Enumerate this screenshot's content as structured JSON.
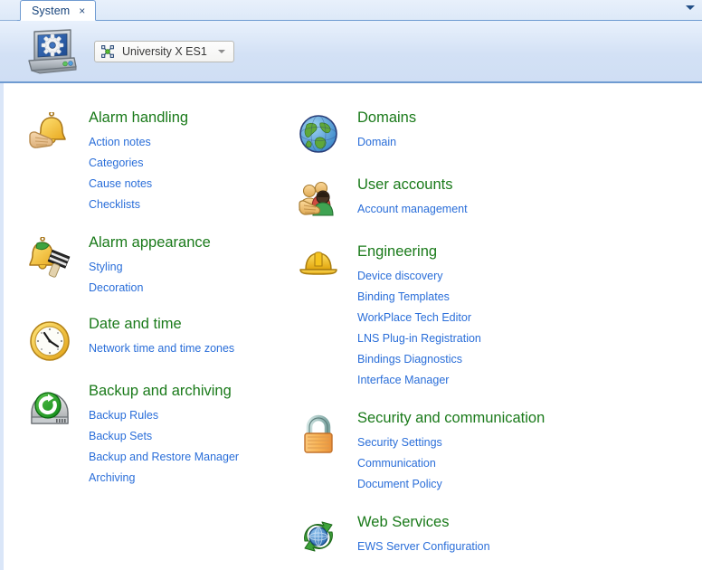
{
  "window": {
    "tab": {
      "label": "System",
      "close_icon": "close-icon",
      "close_glyph": "×"
    },
    "tabstrip_overflow_icon": "chevron-down-icon"
  },
  "header": {
    "app_icon": "laptop-settings-icon",
    "site_selector": {
      "icon": "network-nodes-icon",
      "value": "University X ES1",
      "caret_icon": "chevron-down-icon"
    }
  },
  "columns": {
    "left": [
      {
        "icon": "bell-hand-icon",
        "title": "Alarm handling",
        "links": [
          "Action notes",
          "Categories",
          "Cause notes",
          "Checklists"
        ]
      },
      {
        "icon": "bell-paintbrush-icon",
        "title": "Alarm appearance",
        "links": [
          "Styling",
          "Decoration"
        ]
      },
      {
        "icon": "clock-icon",
        "title": "Date and time",
        "links": [
          "Network time and time zones"
        ]
      },
      {
        "icon": "backup-drive-icon",
        "title": "Backup and archiving",
        "links": [
          "Backup Rules",
          "Backup Sets",
          "Backup and Restore Manager",
          "Archiving"
        ]
      }
    ],
    "right": [
      {
        "icon": "globe-icon",
        "title": "Domains",
        "links": [
          "Domain"
        ]
      },
      {
        "icon": "users-icon",
        "title": "User accounts",
        "links": [
          "Account management"
        ]
      },
      {
        "icon": "hardhat-icon",
        "title": "Engineering",
        "links": [
          "Device discovery",
          "Binding Templates",
          "WorkPlace Tech Editor",
          "LNS Plug-in Registration",
          "Bindings Diagnostics",
          "Interface Manager"
        ]
      },
      {
        "icon": "padlock-icon",
        "title": "Security and communication",
        "links": [
          "Security Settings",
          "Communication",
          "Document Policy"
        ]
      },
      {
        "icon": "web-services-icon",
        "title": "Web Services",
        "links": [
          "EWS Server Configuration"
        ]
      }
    ]
  },
  "colors": {
    "heading_green": "#1a7a1a",
    "link_blue": "#2a6ed9",
    "header_band": "#d3e1f5",
    "border_blue": "#6f9bd1"
  }
}
